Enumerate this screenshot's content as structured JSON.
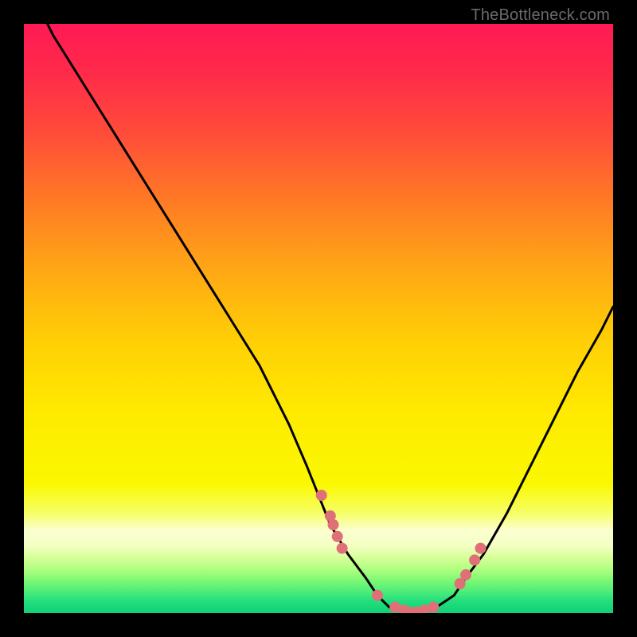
{
  "watermark": "TheBottleneck.com",
  "chart_data": {
    "type": "line",
    "title": "",
    "xlabel": "",
    "ylabel": "",
    "xlim": [
      0,
      100
    ],
    "ylim": [
      0,
      100
    ],
    "curve": {
      "name": "bottleneck-curve",
      "x": [
        0,
        5,
        10,
        15,
        20,
        25,
        30,
        35,
        40,
        45,
        48,
        50,
        52,
        55,
        58,
        60,
        62,
        65,
        68,
        70,
        73,
        75,
        78,
        82,
        86,
        90,
        94,
        98,
        100
      ],
      "y": [
        108,
        98,
        90,
        82,
        74,
        66,
        58,
        50,
        42,
        32,
        25,
        20,
        15,
        10,
        6,
        3,
        1,
        0,
        0,
        1,
        3,
        6,
        10,
        17,
        25,
        33,
        41,
        48,
        52
      ]
    },
    "markers": {
      "name": "data-points",
      "color": "#e07078",
      "x": [
        50.5,
        52,
        52.5,
        53.2,
        54,
        60,
        63,
        64.5,
        65.5,
        66.8,
        68,
        69.5,
        74,
        75,
        76.5,
        77.5
      ],
      "y": [
        20,
        16.5,
        15,
        13,
        11,
        3,
        1,
        0.5,
        0.2,
        0.2,
        0.5,
        1,
        5,
        6.5,
        9,
        11
      ]
    },
    "background_bands": [
      {
        "color": "#ff2050",
        "from_y": 100,
        "to_y": 92
      },
      {
        "color": "#ff3a44",
        "from_y": 92,
        "to_y": 80
      },
      {
        "color": "#ff6a30",
        "from_y": 80,
        "to_y": 68
      },
      {
        "color": "#ff9a20",
        "from_y": 68,
        "to_y": 56
      },
      {
        "color": "#ffc410",
        "from_y": 56,
        "to_y": 44
      },
      {
        "color": "#ffe400",
        "from_y": 44,
        "to_y": 32
      },
      {
        "color": "#f8f800",
        "from_y": 32,
        "to_y": 20
      },
      {
        "color": "#f0ffae",
        "from_y": 20,
        "to_y": 15
      },
      {
        "color": "#fbffd6",
        "from_y": 15,
        "to_y": 11
      },
      {
        "color": "#d0ff8a",
        "from_y": 11,
        "to_y": 8
      },
      {
        "color": "#90ff70",
        "from_y": 8,
        "to_y": 5
      },
      {
        "color": "#3cf080",
        "from_y": 5,
        "to_y": 2
      },
      {
        "color": "#16d87a",
        "from_y": 2,
        "to_y": 0
      }
    ]
  }
}
